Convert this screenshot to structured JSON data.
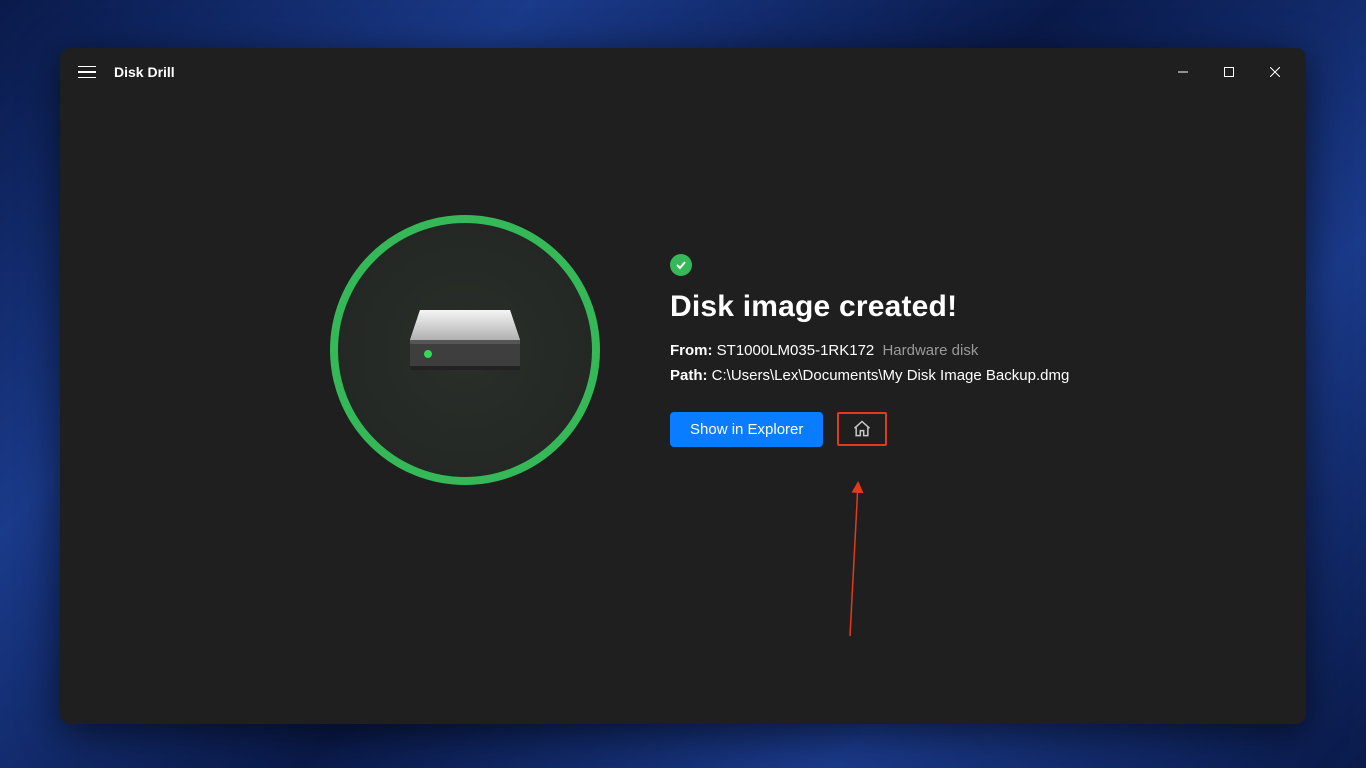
{
  "titlebar": {
    "app_title": "Disk Drill"
  },
  "main": {
    "heading": "Disk image created!",
    "from_label": "From:",
    "from_value": "ST1000LM035-1RK172",
    "from_type": "Hardware disk",
    "path_label": "Path:",
    "path_value": "C:\\Users\\Lex\\Documents\\My Disk Image Backup.dmg",
    "actions": {
      "show_in_explorer": "Show in Explorer"
    }
  }
}
